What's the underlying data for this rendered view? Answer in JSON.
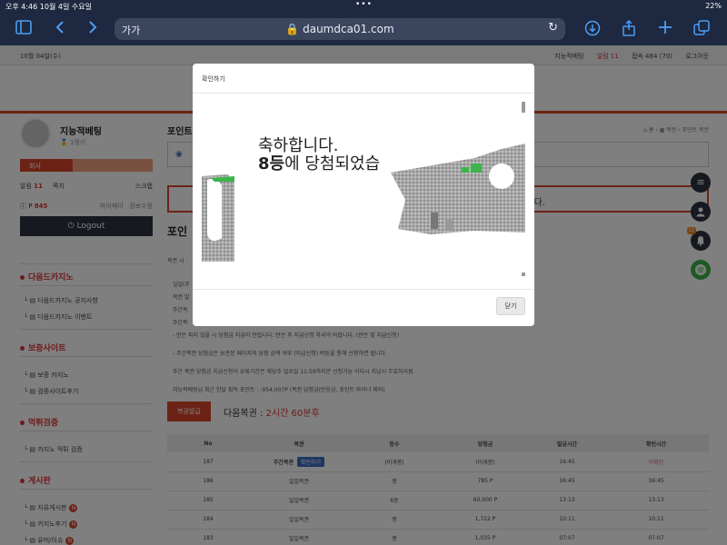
{
  "status_bar": {
    "time_date": "오후 4:46   10월 4일 수요일",
    "dots": "•••",
    "right": "22%"
  },
  "browser": {
    "text_size": "가가",
    "url": "🔒 daumdca01.com",
    "reload_icon": "↻",
    "icons": [
      "sidebar-icon",
      "back-icon",
      "forward-icon",
      "reload-icon",
      "download-icon",
      "share-icon",
      "new-tab-icon",
      "tabs-icon"
    ]
  },
  "topstrip": {
    "date": "10월 04일(수)",
    "links": [
      "지능적베팅",
      "알림 11",
      "접속 484 (70)",
      "로그아웃"
    ]
  },
  "user": {
    "name": "지능적베팅",
    "level": "🥇 1랭키",
    "bar_label": "회사",
    "bar_fraction": 0.4,
    "stats": {
      "alert_label": "알림",
      "alert_count": "11",
      "scrap": "쪽지",
      "scrap_right": "스크랩"
    },
    "points": {
      "label": "P",
      "value": "845",
      "r1": "마이페이",
      "r2": "정보수정"
    },
    "logout": "⏻ Logout"
  },
  "menus": [
    {
      "title": "다음드카지노",
      "items": [
        "다음드카지노 공지사항",
        "다음드카지노 이벤트"
      ]
    },
    {
      "title": "보증사이트",
      "items": [
        "보증 카지노",
        "검증사이트후기"
      ]
    },
    {
      "title": "먹튀검증",
      "items": [
        "카지노 먹튀 검증"
      ]
    },
    {
      "title": "게시판",
      "items": [
        "자유게시판",
        "카지노후기",
        "유머/이슈"
      ]
    }
  ],
  "content": {
    "title": "포인트",
    "crumb": "⌂ 홈 › ▦ 복권 › 포인트 복권",
    "redbox_text": "다.",
    "section_title": "포인",
    "small_note": "복권 시",
    "lines": [
      "일일(주",
      "복권 발",
      "주간복",
      "주간복",
      "- 반은 파지 않을 시 당첨금 지급이 안됩니다. 반은 후 지급신청 하셔야 바랍니다. (반은 및 지급신청)",
      "- 주간복권 당첨금은 보관된 페이지의 당첨 금액 여부 (지급신청) 버튼을 통해 신청하면 됩니다.",
      "주간 복권 당첨금 지급신청이 요류기간은 해당주 일요일 11:59까지만 신청가능 이다시 지났시 무효처리됨.",
      "지능적베팅님 최근 한달 획득 포인트 : -954,007P (복권 당첨금(반응금, 포인트 마이너 제외)"
    ],
    "draw_button": "복권발급",
    "next_draw_label": "다음복권 :",
    "next_draw_time": "2시간 60분후",
    "table": {
      "headers": [
        "No",
        "복권",
        "등수",
        "당첨금",
        "발급시간",
        "확인시간"
      ],
      "rows": [
        [
          "187",
          "주간복권",
          "(미개봉)",
          "(미개봉)",
          "16:45",
          "미확인",
          "확인하기"
        ],
        [
          "186",
          "일일복권",
          "꽝",
          "785 P",
          "16:45",
          "16:45",
          ""
        ],
        [
          "185",
          "일일복권",
          "6등",
          "60,000 P",
          "13:13",
          "13:13",
          ""
        ],
        [
          "184",
          "일일복권",
          "꽝",
          "1,722 P",
          "10:11",
          "10:11",
          ""
        ],
        [
          "183",
          "일일복권",
          "꽝",
          "1,035 P",
          "07:07",
          "07:07",
          ""
        ]
      ]
    }
  },
  "floating": {
    "menu_icon": "≡",
    "user_icon": "👤",
    "bell_icon": "🔔",
    "bell_badge": "11",
    "chat_icon": "●"
  },
  "modal": {
    "title": "확인하기",
    "line1": "축하합니다.",
    "rank": "8등",
    "line2_rest": "에 당첨되었습",
    "close": "닫기"
  },
  "colors": {
    "accent": "#d9472b",
    "toolbar": "#1e2840",
    "link_blue": "#4a9ef5"
  }
}
